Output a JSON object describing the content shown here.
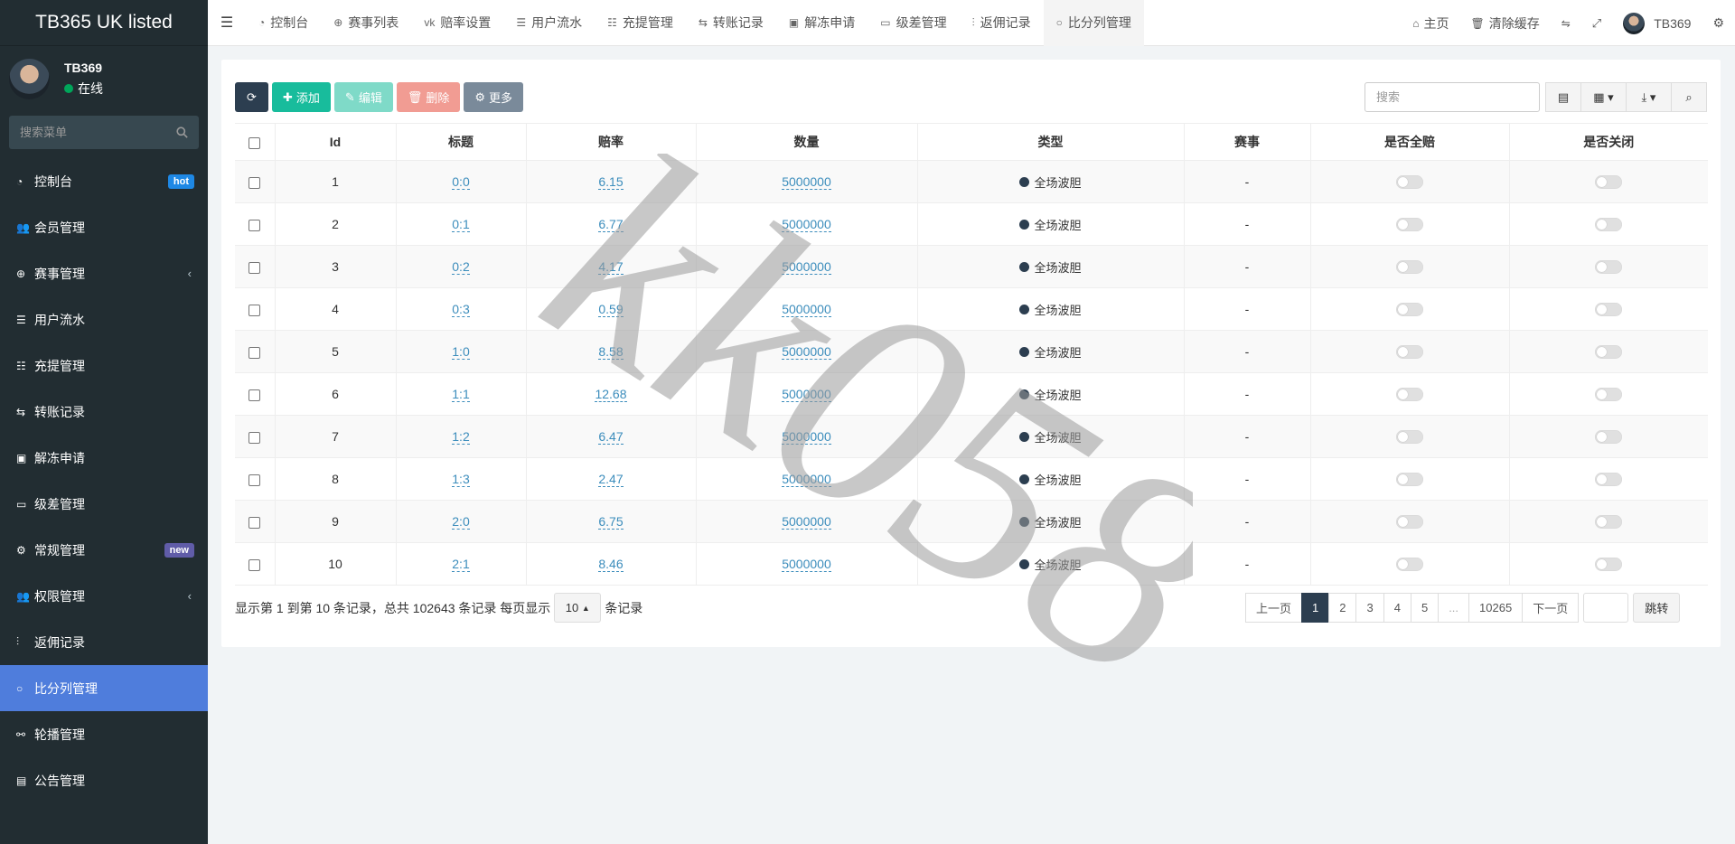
{
  "app": {
    "title": "TB365 UK listed"
  },
  "user": {
    "name": "TB369",
    "status": "在线"
  },
  "sidebar": {
    "search_placeholder": "搜索菜单",
    "items": [
      {
        "label": "控制台",
        "icon": "dashboard-icon",
        "badge": "hot"
      },
      {
        "label": "会员管理",
        "icon": "users-icon"
      },
      {
        "label": "赛事管理",
        "icon": "globe-icon",
        "chevron": true
      },
      {
        "label": "用户流水",
        "icon": "list-icon"
      },
      {
        "label": "充提管理",
        "icon": "list-alt-icon"
      },
      {
        "label": "转账记录",
        "icon": "exchange-icon"
      },
      {
        "label": "解冻申请",
        "icon": "image-icon"
      },
      {
        "label": "级差管理",
        "icon": "window-icon"
      },
      {
        "label": "常规管理",
        "icon": "cogs-icon",
        "badge": "new"
      },
      {
        "label": "权限管理",
        "icon": "group-icon",
        "chevron": true
      },
      {
        "label": "返佣记录",
        "icon": "handshake-icon"
      },
      {
        "label": "比分列管理",
        "icon": "circle-icon",
        "active": true
      },
      {
        "label": "轮播管理",
        "icon": "carousel-icon"
      },
      {
        "label": "公告管理",
        "icon": "notice-icon"
      }
    ]
  },
  "topnav": {
    "tabs": [
      {
        "label": "控制台",
        "icon": "dashboard-icon"
      },
      {
        "label": "赛事列表",
        "icon": "globe-icon"
      },
      {
        "label": "赔率设置",
        "icon": "vk-icon"
      },
      {
        "label": "用户流水",
        "icon": "list-icon"
      },
      {
        "label": "充提管理",
        "icon": "list-alt-icon"
      },
      {
        "label": "转账记录",
        "icon": "exchange-icon"
      },
      {
        "label": "解冻申请",
        "icon": "image-icon"
      },
      {
        "label": "级差管理",
        "icon": "window-icon"
      },
      {
        "label": "返佣记录",
        "icon": "handshake-icon"
      },
      {
        "label": "比分列管理",
        "icon": "circle-icon",
        "active": true
      }
    ],
    "home": "主页",
    "clear_cache": "清除缓存",
    "user": "TB369"
  },
  "toolbar": {
    "add": "添加",
    "edit": "编辑",
    "delete": "删除",
    "more": "更多",
    "search_placeholder": "搜索"
  },
  "table": {
    "headers": [
      "Id",
      "标题",
      "赔率",
      "数量",
      "类型",
      "赛事",
      "是否全赔",
      "是否关闭"
    ],
    "rows": [
      {
        "id": "1",
        "title": "0:0",
        "odds": "6.15",
        "qty": "5000000",
        "type": "全场波胆",
        "event": "-"
      },
      {
        "id": "2",
        "title": "0:1",
        "odds": "6.77",
        "qty": "5000000",
        "type": "全场波胆",
        "event": "-"
      },
      {
        "id": "3",
        "title": "0:2",
        "odds": "4.17",
        "qty": "5000000",
        "type": "全场波胆",
        "event": "-"
      },
      {
        "id": "4",
        "title": "0:3",
        "odds": "0.59",
        "qty": "5000000",
        "type": "全场波胆",
        "event": "-"
      },
      {
        "id": "5",
        "title": "1:0",
        "odds": "8.58",
        "qty": "5000000",
        "type": "全场波胆",
        "event": "-"
      },
      {
        "id": "6",
        "title": "1:1",
        "odds": "12.68",
        "qty": "5000000",
        "type": "全场波胆",
        "event": "-"
      },
      {
        "id": "7",
        "title": "1:2",
        "odds": "6.47",
        "qty": "5000000",
        "type": "全场波胆",
        "event": "-"
      },
      {
        "id": "8",
        "title": "1:3",
        "odds": "2.47",
        "qty": "5000000",
        "type": "全场波胆",
        "event": "-"
      },
      {
        "id": "9",
        "title": "2:0",
        "odds": "6.75",
        "qty": "5000000",
        "type": "全场波胆",
        "event": "-"
      },
      {
        "id": "10",
        "title": "2:1",
        "odds": "8.46",
        "qty": "5000000",
        "type": "全场波胆",
        "event": "-"
      }
    ]
  },
  "footer": {
    "info_prefix": "显示第 1 到第 10 条记录，总共 102643 条记录 每页显示",
    "per_page": "10",
    "info_suffix": "条记录"
  },
  "pagination": {
    "prev": "上一页",
    "pages": [
      "1",
      "2",
      "3",
      "4",
      "5",
      "...",
      "10265"
    ],
    "next": "下一页",
    "jump": "跳转"
  },
  "watermark": "kk058"
}
